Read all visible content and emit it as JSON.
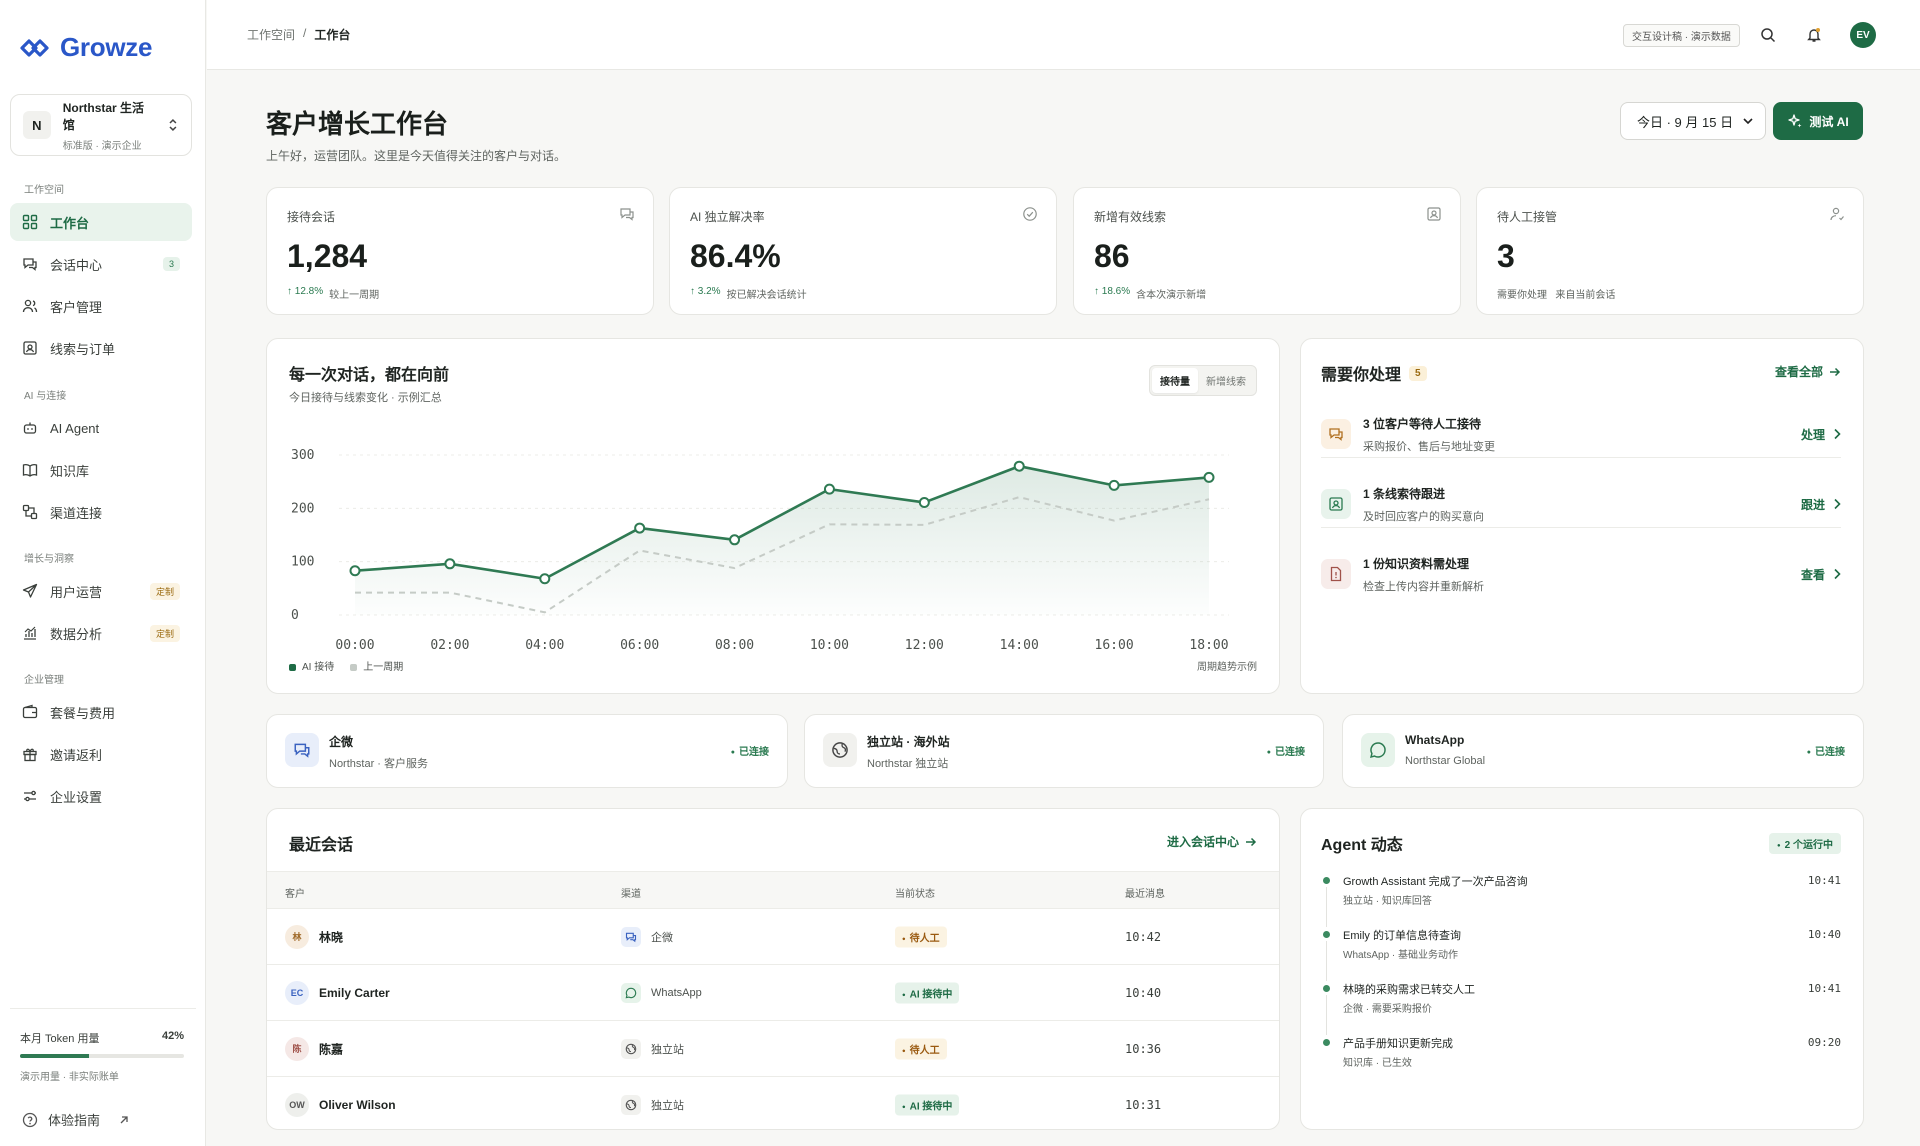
{
  "brand": {
    "name": "Growze"
  },
  "org": {
    "initial": "N",
    "name": "Northstar 生活馆",
    "plan": "标准版 · 演示企业"
  },
  "nav": {
    "sections": [
      "工作空间",
      "AI 与连接",
      "增长与洞察",
      "企业管理"
    ],
    "items": [
      {
        "label": "工作台",
        "badge": ""
      },
      {
        "label": "会话中心",
        "badge": "3"
      },
      {
        "label": "客户管理",
        "badge": ""
      },
      {
        "label": "线索与订单",
        "badge": ""
      },
      {
        "label": "AI Agent",
        "badge": ""
      },
      {
        "label": "知识库",
        "badge": ""
      },
      {
        "label": "渠道连接",
        "badge": ""
      },
      {
        "label": "用户运营",
        "badge": "定制"
      },
      {
        "label": "数据分析",
        "badge": "定制"
      },
      {
        "label": "套餐与费用",
        "badge": ""
      },
      {
        "label": "邀请返利",
        "badge": ""
      },
      {
        "label": "企业设置",
        "badge": ""
      }
    ]
  },
  "token": {
    "label": "本月 Token 用量",
    "percent_text": "42%",
    "percent": 42,
    "note": "演示用量 · 非实际账单"
  },
  "guide": {
    "label": "体验指南"
  },
  "breadcrumb": {
    "root": "工作空间",
    "sep": "/",
    "current": "工作台"
  },
  "topbar": {
    "demo_tag": "交互设计稿 · 演示数据",
    "avatar": "EV"
  },
  "header": {
    "title": "客户增长工作台",
    "subtitle": "上午好，运营团队。这里是今天值得关注的客户与对话。",
    "date": "今日 · 9 月 15 日",
    "test_ai": "测试 AI"
  },
  "kpis": [
    {
      "label": "接待会话",
      "value": "1,284",
      "delta": "↑ 12.8%",
      "note": "较上一周期"
    },
    {
      "label": "AI 独立解决率",
      "value": "86.4%",
      "delta": "↑ 3.2%",
      "note": "按已解决会话统计"
    },
    {
      "label": "新增有效线索",
      "value": "86",
      "delta": "↑ 18.6%",
      "note": "含本次演示新增"
    },
    {
      "label": "待人工接管",
      "value": "3",
      "delta": "",
      "note": "需要你处理   来自当前会话"
    }
  ],
  "chart": {
    "title": "每一次对话，都在向前",
    "subtitle": "今日接待与线索变化 · 示例汇总",
    "tabs": [
      "接待量",
      "新增线索"
    ],
    "note": "周期趋势示例"
  },
  "chart_data": {
    "type": "line",
    "x": [
      "00:00",
      "02:00",
      "04:00",
      "06:00",
      "08:00",
      "10:00",
      "12:00",
      "14:00",
      "16:00",
      "18:00"
    ],
    "yticks": [
      0,
      100,
      200,
      300
    ],
    "ylim": [
      0,
      300
    ],
    "series": [
      {
        "name": "AI 接待",
        "values": [
          83,
          96,
          68,
          163,
          141,
          236,
          211,
          279,
          243,
          258
        ],
        "color": "#2f7a53"
      },
      {
        "name": "上一周期",
        "values": [
          42,
          42,
          5,
          121,
          88,
          170,
          169,
          221,
          177,
          217
        ],
        "color": "#c5cbc6"
      }
    ]
  },
  "tasks": {
    "title": "需要你处理",
    "count": "5",
    "view_all": "查看全部",
    "items": [
      {
        "title": "3 位客户等待人工接待",
        "sub": "采购报价、售后与地址变更",
        "action": "处理"
      },
      {
        "title": "1 条线索待跟进",
        "sub": "及时回应客户的购买意向",
        "action": "跟进"
      },
      {
        "title": "1 份知识资料需处理",
        "sub": "检查上传内容并重新解析",
        "action": "查看"
      }
    ]
  },
  "channels": [
    {
      "name": "企微",
      "sub": "Northstar · 客户服务",
      "status": "已连接"
    },
    {
      "name": "独立站 · 海外站",
      "sub": "Northstar 独立站",
      "status": "已连接"
    },
    {
      "name": "WhatsApp",
      "sub": "Northstar Global",
      "status": "已连接"
    }
  ],
  "conversations": {
    "title": "最近会话",
    "link": "进入会话中心",
    "headers": [
      "客户",
      "渠道",
      "当前状态",
      "最近消息"
    ],
    "rows": [
      {
        "initial": "林",
        "name": "林晓",
        "channel": "企微",
        "state": "待人工",
        "time": "10:42"
      },
      {
        "initial": "EC",
        "name": "Emily Carter",
        "channel": "WhatsApp",
        "state": "AI 接待中",
        "time": "10:40"
      },
      {
        "initial": "陈",
        "name": "陈嘉",
        "channel": "独立站",
        "state": "待人工",
        "time": "10:36"
      },
      {
        "initial": "OW",
        "name": "Oliver Wilson",
        "channel": "独立站",
        "state": "AI 接待中",
        "time": "10:31"
      }
    ]
  },
  "agent": {
    "title": "Agent 动态",
    "running": "2 个运行中",
    "feed": [
      {
        "title": "Growth Assistant 完成了一次产品咨询",
        "sub": "独立站 · 知识库回答",
        "time": "10:41"
      },
      {
        "title": "Emily 的订单信息待查询",
        "sub": "WhatsApp · 基础业务动作",
        "time": "10:40"
      },
      {
        "title": "林晓的采购需求已转交人工",
        "sub": "企微 · 需要采购报价",
        "time": "10:41"
      },
      {
        "title": "产品手册知识更新完成",
        "sub": "知识库 · 已生效",
        "time": "09:20"
      }
    ]
  }
}
